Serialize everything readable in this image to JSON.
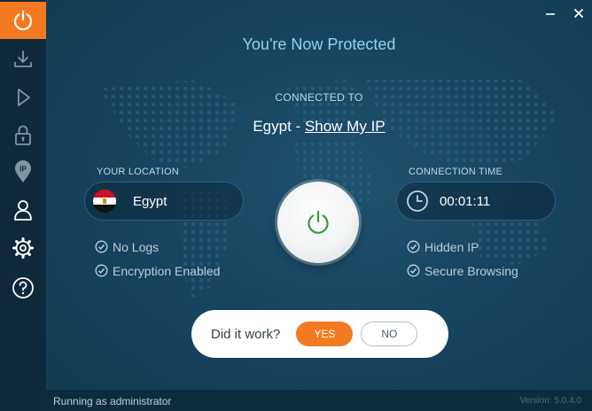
{
  "app": {
    "title": "You're Now Protected",
    "connected_label": "CONNECTED TO",
    "connected_location": "Egypt",
    "connected_separator": " - ",
    "show_ip_link": "Show My IP"
  },
  "sidebar": {
    "items": [
      {
        "name": "power",
        "icon": "power-icon",
        "active": true
      },
      {
        "name": "download",
        "icon": "download-icon",
        "active": false
      },
      {
        "name": "play",
        "icon": "play-icon",
        "active": false
      },
      {
        "name": "lock",
        "icon": "lock-icon",
        "active": false
      },
      {
        "name": "ip",
        "icon": "ip-pin-icon",
        "active": false
      },
      {
        "name": "account",
        "icon": "user-icon",
        "active": false
      },
      {
        "name": "settings",
        "icon": "gear-icon",
        "active": false
      },
      {
        "name": "help",
        "icon": "help-icon",
        "active": false
      }
    ]
  },
  "location": {
    "label": "YOUR LOCATION",
    "value": "Egypt",
    "features": [
      "No Logs",
      "Encryption Enabled"
    ]
  },
  "connection": {
    "label": "CONNECTION TIME",
    "value": "00:01:11",
    "features": [
      "Hidden IP",
      "Secure Browsing"
    ]
  },
  "feedback": {
    "question": "Did it work?",
    "yes_label": "YES",
    "no_label": "NO"
  },
  "status": {
    "text": "Running as administrator",
    "version": "Version: 5.0.4.0"
  },
  "colors": {
    "accent": "#f37a21",
    "sidebar_bg": "#10293a",
    "main_bg": "#174460",
    "title": "#8fd3f0",
    "power_ring": "#2e9e3e"
  }
}
